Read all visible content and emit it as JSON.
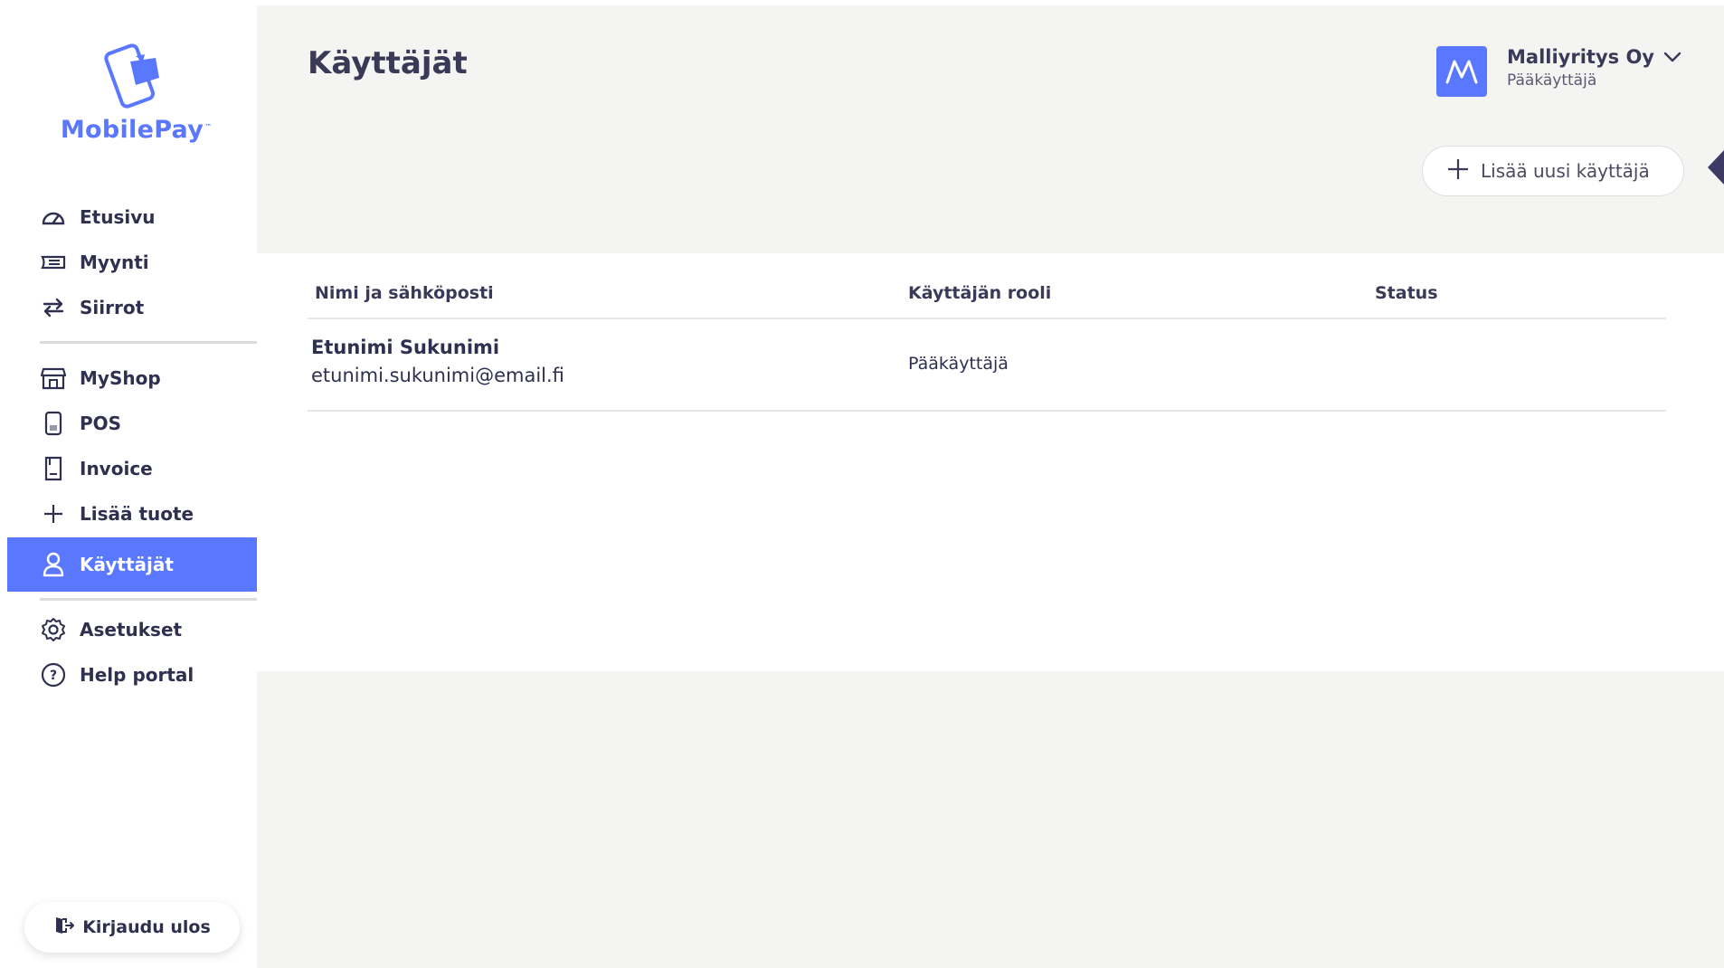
{
  "brand": {
    "name": "MobilePay",
    "tm": "™",
    "color": "#5a78ff"
  },
  "sidebar": {
    "items": [
      {
        "label": "Etusivu",
        "icon": "dashboard-icon"
      },
      {
        "label": "Myynti",
        "icon": "ticket-icon"
      },
      {
        "label": "Siirrot",
        "icon": "transfer-arrows-icon"
      },
      {
        "label": "MyShop",
        "icon": "shop-icon"
      },
      {
        "label": "POS",
        "icon": "pos-terminal-icon"
      },
      {
        "label": "Invoice",
        "icon": "invoice-icon"
      },
      {
        "label": "Lisää tuote",
        "icon": "plus-icon"
      },
      {
        "label": "Käyttäjät",
        "icon": "user-icon",
        "active": true
      },
      {
        "label": "Asetukset",
        "icon": "gear-icon"
      },
      {
        "label": "Help portal",
        "icon": "help-icon"
      }
    ],
    "logout_label": "Kirjaudu ulos"
  },
  "header": {
    "title": "Käyttäjät",
    "account": {
      "company": "Malliyritys Oy",
      "role": "Pääkäyttäjä",
      "avatar_letter": "M"
    },
    "add_user_label": "Lisää uusi käyttäjä"
  },
  "table": {
    "columns": [
      "Nimi ja sähköposti",
      "Käyttäjän rooli",
      "Status"
    ],
    "rows": [
      {
        "name": "Etunimi Sukunimi",
        "email": "etunimi.sukunimi@email.fi",
        "role": "Pääkäyttäjä",
        "status": ""
      }
    ]
  }
}
